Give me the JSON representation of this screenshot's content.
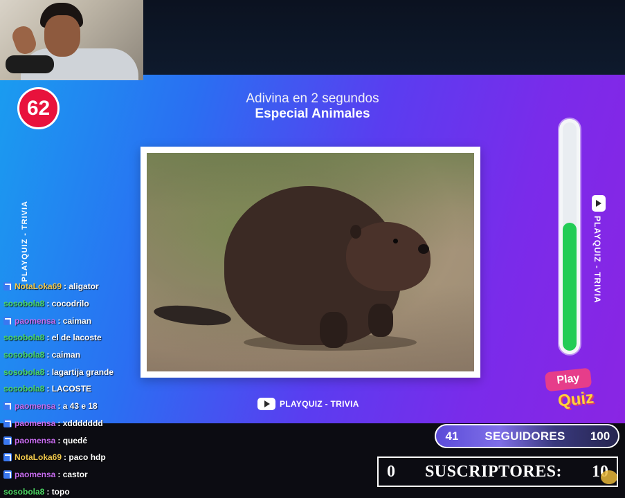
{
  "counter": {
    "value": "62"
  },
  "header": {
    "line1": "Adivina en 2 segundos",
    "line2": "Especial Animales"
  },
  "image": {
    "subject": "beaver"
  },
  "channel": {
    "label": "PLAYQUIZ - TRIVIA"
  },
  "side_labels": {
    "left": "PLAYQUIZ - TRIVIA",
    "right": "PLAYQUIZ - TRIVIA"
  },
  "timer": {
    "remaining_fraction": 0.56,
    "fill_color": "#22cc55"
  },
  "logo": {
    "line1": "Play",
    "line2": "Quiz"
  },
  "chat": [
    {
      "user": "NotaLoka69",
      "message": ": aligator",
      "user_color": "#f2c94c",
      "badge": true
    },
    {
      "user": "sosobola8",
      "message": ": cocodrilo",
      "user_color": "#4cd964",
      "badge": false
    },
    {
      "user": "paomensa",
      "message": ": caiman",
      "user_color": "#c86cf0",
      "badge": true
    },
    {
      "user": "sosobola8",
      "message": ": el de lacoste",
      "user_color": "#4cd964",
      "badge": false
    },
    {
      "user": "sosobola8",
      "message": ": caiman",
      "user_color": "#4cd964",
      "badge": false
    },
    {
      "user": "sosobola8",
      "message": ": lagartija grande",
      "user_color": "#4cd964",
      "badge": false
    },
    {
      "user": "sosobola8",
      "message": ": LACOSTE",
      "user_color": "#4cd964",
      "badge": false
    },
    {
      "user": "paomensa",
      "message": ": a 43 e 18",
      "user_color": "#c86cf0",
      "badge": true
    },
    {
      "user": "paomensa",
      "message": ": xddddddd",
      "user_color": "#c86cf0",
      "badge": true
    },
    {
      "user": "paomensa",
      "message": ": quedé",
      "user_color": "#c86cf0",
      "badge": true
    },
    {
      "user": "NotaLoka69",
      "message": ": paco hdp",
      "user_color": "#f2c94c",
      "badge": true
    },
    {
      "user": "paomensa",
      "message": ": castor",
      "user_color": "#c86cf0",
      "badge": true
    },
    {
      "user": "sosobola8",
      "message": ": topo",
      "user_color": "#4cd964",
      "badge": false
    }
  ],
  "followers_goal": {
    "current": "41",
    "label": "SEGUIDORES",
    "target": "100"
  },
  "subscribers_goal": {
    "current": "0",
    "label": "SUSCRIPTORES:",
    "target": "10"
  },
  "colors": {
    "counter_bg": "#e8123c",
    "stage_left": "#1a9cf0",
    "stage_right": "#8a25e3"
  }
}
